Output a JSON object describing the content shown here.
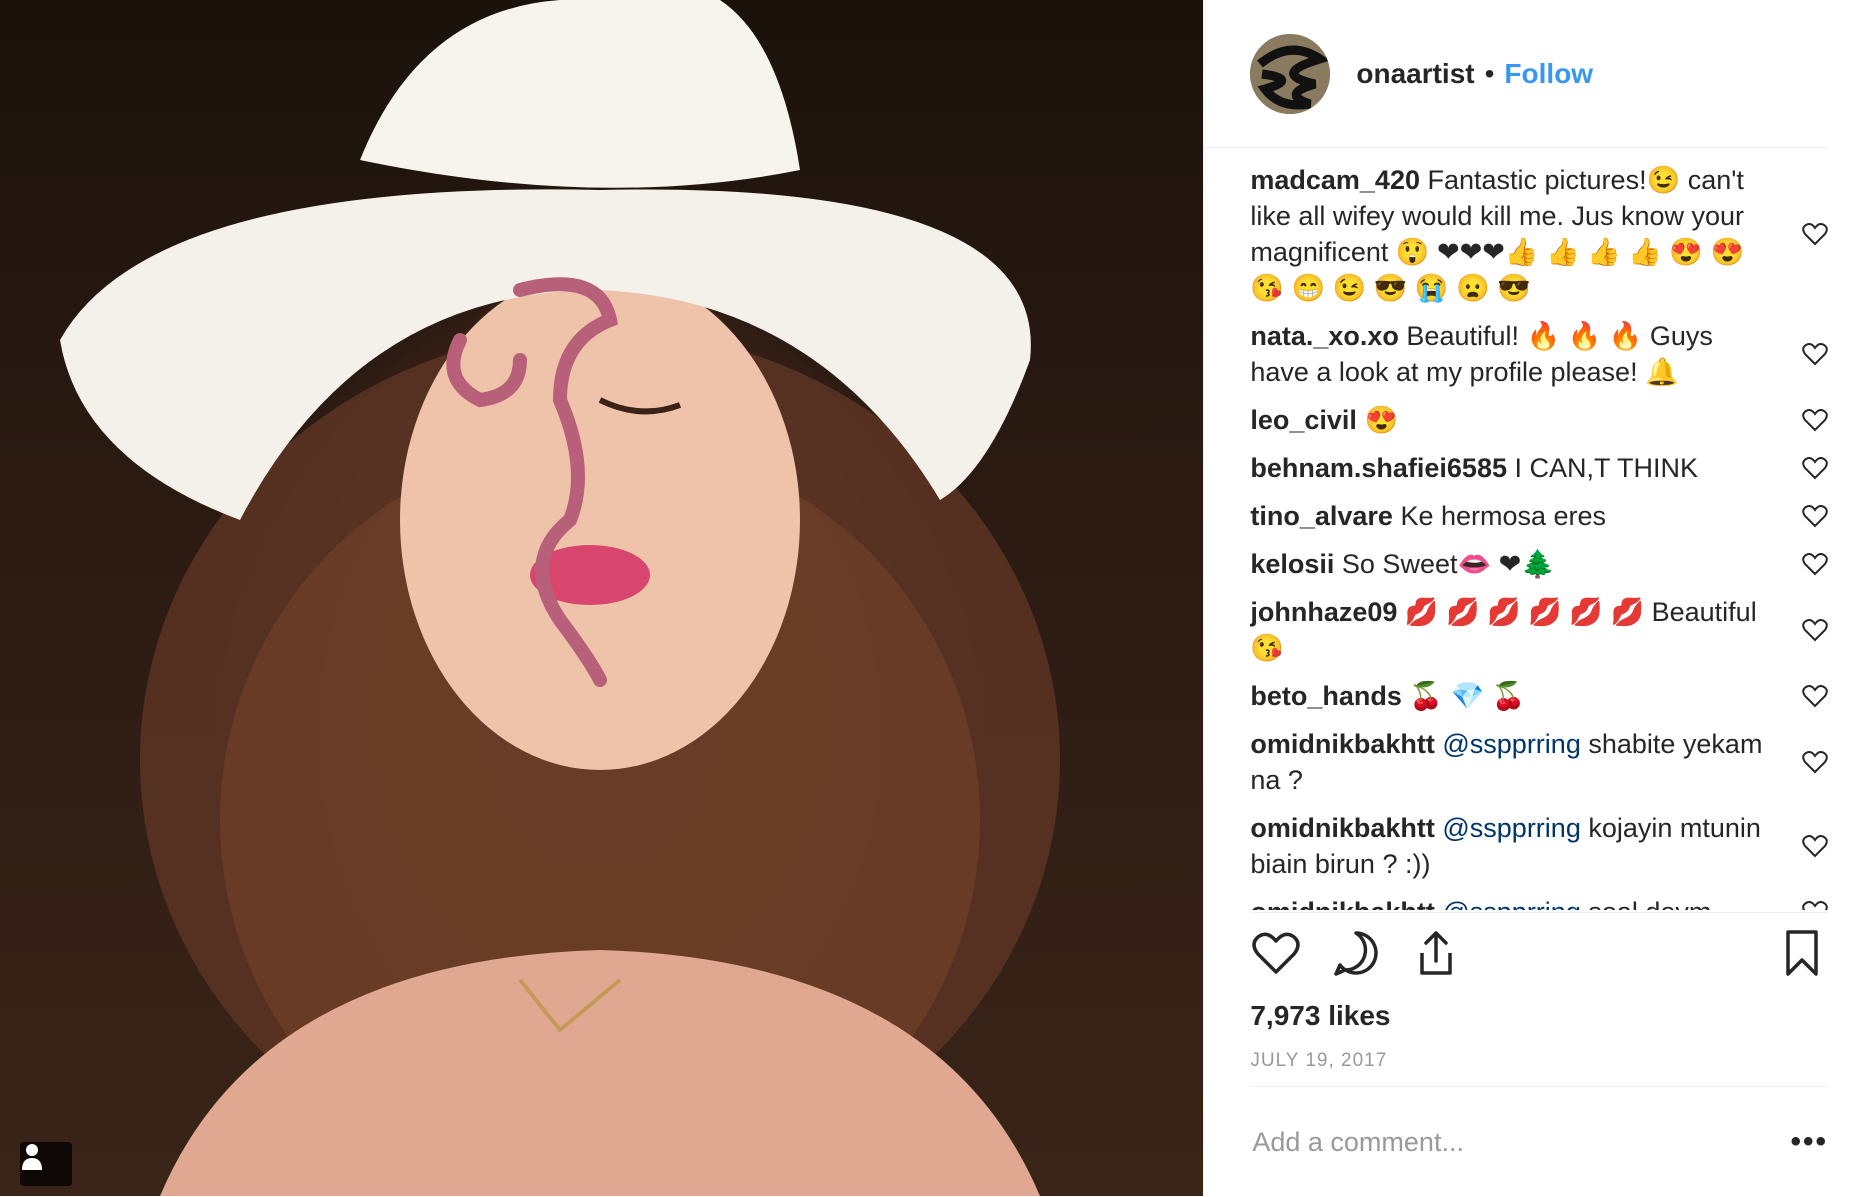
{
  "header": {
    "username": "onaartist",
    "separator": "•",
    "follow_label": "Follow"
  },
  "comments": [
    {
      "user": "madcam_420",
      "text": " Fantastic pictures!😉 can't like all wifey would kill me. Jus know your magnificent 😲 ❤❤❤👍 👍 👍 👍 😍 😍 😘 😁 😉 😎 😭 😦 😎"
    },
    {
      "user": "nata._xo.xo",
      "text": " Beautiful! 🔥 🔥 🔥 Guys have a look at my profile please! 🔔"
    },
    {
      "user": "leo_civil",
      "text": " 😍"
    },
    {
      "user": "behnam.shafiei6585",
      "text": " I CAN,T THINK"
    },
    {
      "user": "tino_alvare",
      "text": " Ke hermosa eres"
    },
    {
      "user": "kelosii",
      "text": " So Sweet👄 ❤🌲"
    },
    {
      "user": "johnhaze09",
      "text": " 💋 💋 💋 💋 💋 💋 Beautiful 😘"
    },
    {
      "user": "beto_hands",
      "text": " 🍒 💎 🍒"
    },
    {
      "user": "omidnikbakhtt",
      "mention": " @sspprring",
      "text": " shabite yekam na ?"
    },
    {
      "user": "omidnikbakhtt",
      "mention": " @sspprring",
      "text": " kojayin mtunin biain birun ? :))"
    },
    {
      "user": "omidnikbakhtt",
      "mention": " @sspprring",
      "text": " soal dovm"
    }
  ],
  "likes": "7,973 likes",
  "date": "JULY 19, 2017",
  "add_comment": {
    "placeholder": "Add a comment..."
  },
  "more_label": "•••",
  "icons": {
    "like": "heart-icon",
    "comment": "comment-icon",
    "share": "share-icon",
    "save": "bookmark-icon",
    "tag": "user-tag-icon"
  }
}
